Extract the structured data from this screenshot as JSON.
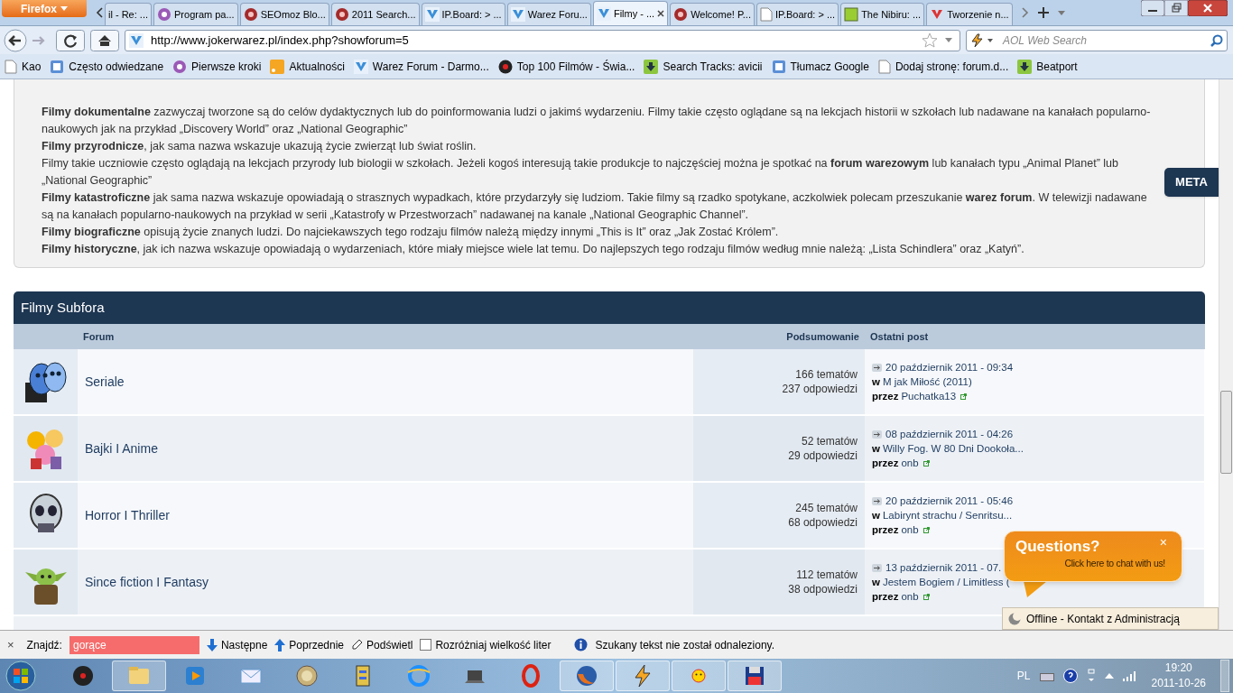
{
  "browser": {
    "menu_button": "Firefox",
    "tabs": [
      {
        "label": "il - Re: ...",
        "selected": false
      },
      {
        "label": "Program pa...",
        "selected": false
      },
      {
        "label": "SEOmoz Blo...",
        "selected": false
      },
      {
        "label": "2011 Search...",
        "selected": false
      },
      {
        "label": "IP.Board: > ...",
        "selected": false
      },
      {
        "label": "Warez Foru...",
        "selected": false
      },
      {
        "label": "Filmy - ...",
        "selected": true
      },
      {
        "label": "Welcome! P...",
        "selected": false
      },
      {
        "label": "IP.Board: > ...",
        "selected": false
      },
      {
        "label": "The Nibiru: ...",
        "selected": false
      },
      {
        "label": "Tworzenie n...",
        "selected": false
      }
    ],
    "url": "http://www.jokerwarez.pl/index.php?showforum=5",
    "search_placeholder": "AOL Web Search",
    "bookmarks": [
      "Kao",
      "Często odwiedzane",
      "Pierwsze kroki",
      "Aktualności",
      "Warez Forum - Darmo...",
      "Top 100 Filmów - Świa...",
      "Search Tracks: avicii",
      "Tłumacz Google",
      "Dodaj stronę: forum.d...",
      "Beatport"
    ]
  },
  "description": [
    "**Filmy dokumentalne** zazwyczaj tworzone są do celów dydaktycznych lub do poinformowania ludzi o jakimś wydarzeniu. Filmy takie często oglądane są na lekcjach historii w szkołach lub nadawane na kanałach popularno-naukowych jak na przykład „Discovery World” oraz „National Geographic”",
    "**Filmy przyrodnicze**, jak sama nazwa wskazuje ukazują życie zwierząt lub świat roślin.",
    "Filmy takie uczniowie często oglądają na lekcjach przyrody lub biologii w szkołach. Jeżeli kogoś interesują takie produkcje to najczęściej można je spotkać na **forum warezowym** lub kanałach typu „Animal Planet” lub „National Geographic”",
    "**Filmy katastroficzne** jak sama nazwa wskazuje opowiadają o strasznych wypadkach, które przydarzyły się ludziom. Takie filmy są rzadko spotykane, aczkolwiek polecam przeszukanie **warez forum**. W telewizji nadawane są na kanałach popularno-naukowych na przykład w serii „Katastrofy w Przestworzach” nadawanej na kanale „National Geographic Channel”.",
    "**Filmy biograficzne** opisują życie znanych ludzi. Do najciekawszych tego rodzaju filmów należą między innymi „This is It” oraz „Jak Zostać Królem”.",
    "**Filmy historyczne**, jak ich nazwa wskazuje opowiadają o wydarzeniach, które miały miejsce wiele lat temu. Do najlepszych tego rodzaju filmów według mnie należą: „Lista Schindlera” oraz „Katyń”."
  ],
  "meta_tab": "META",
  "subforums": {
    "title": "Filmy Subfora",
    "columns": [
      "Forum",
      "Podsumowanie",
      "Ostatni post"
    ],
    "rows": [
      {
        "name": "Seriale",
        "topics": "166 tematów",
        "replies": "237 odpowiedzi",
        "date": "20 październik 2011 - 09:34",
        "in": "w",
        "topic": "M jak Miłość (2011)",
        "by": "przez",
        "user": "Puchatka13"
      },
      {
        "name": "Bajki I Anime",
        "topics": "52 tematów",
        "replies": "29 odpowiedzi",
        "date": "08 październik 2011 - 04:26",
        "in": "w",
        "topic": "Willy Fog. W 80 Dni Dookoła...",
        "by": "przez",
        "user": "onb"
      },
      {
        "name": "Horror I Thriller",
        "topics": "245 tematów",
        "replies": "68 odpowiedzi",
        "date": "20 październik 2011 - 05:46",
        "in": "w",
        "topic": "Labirynt strachu / Senritsu...",
        "by": "przez",
        "user": "onb"
      },
      {
        "name": "Since fiction I Fantasy",
        "topics": "112 tematów",
        "replies": "38 odpowiedzi",
        "date": "13 październik 2011 - 07.",
        "in": "w",
        "topic": "Jestem Bogiem / Limitless (",
        "by": "przez",
        "user": "onb"
      }
    ]
  },
  "chat_popup": {
    "title": "Questions?",
    "subtitle": "Click here to chat with us!",
    "close": "×"
  },
  "chat_bar": "Offline - Kontakt z Administracją",
  "find_bar": {
    "close": "×",
    "label": "Znajdź:",
    "value": "gorące",
    "not_found": true,
    "next": "Następne",
    "previous": "Poprzednie",
    "highlight": "Podświetl",
    "match_case": {
      "label": "Rozróżniaj wielkość liter",
      "checked": false
    },
    "message": "Szukany tekst nie został odnaleziony."
  },
  "taskbar": {
    "apps": [
      {
        "kind": "disc",
        "running": false
      },
      {
        "kind": "folder",
        "running": true
      },
      {
        "kind": "player",
        "running": false
      },
      {
        "kind": "mail",
        "running": false
      },
      {
        "kind": "badge",
        "running": false
      },
      {
        "kind": "archive",
        "running": false
      },
      {
        "kind": "globe",
        "running": false
      },
      {
        "kind": "laptop",
        "running": false
      },
      {
        "kind": "ring",
        "running": false
      },
      {
        "kind": "fox",
        "running": true
      },
      {
        "kind": "bolt",
        "running": true
      },
      {
        "kind": "sun",
        "running": true
      },
      {
        "kind": "floppy",
        "running": true
      }
    ],
    "language": "PL",
    "time": "19:20",
    "date": "2011-10-26"
  }
}
